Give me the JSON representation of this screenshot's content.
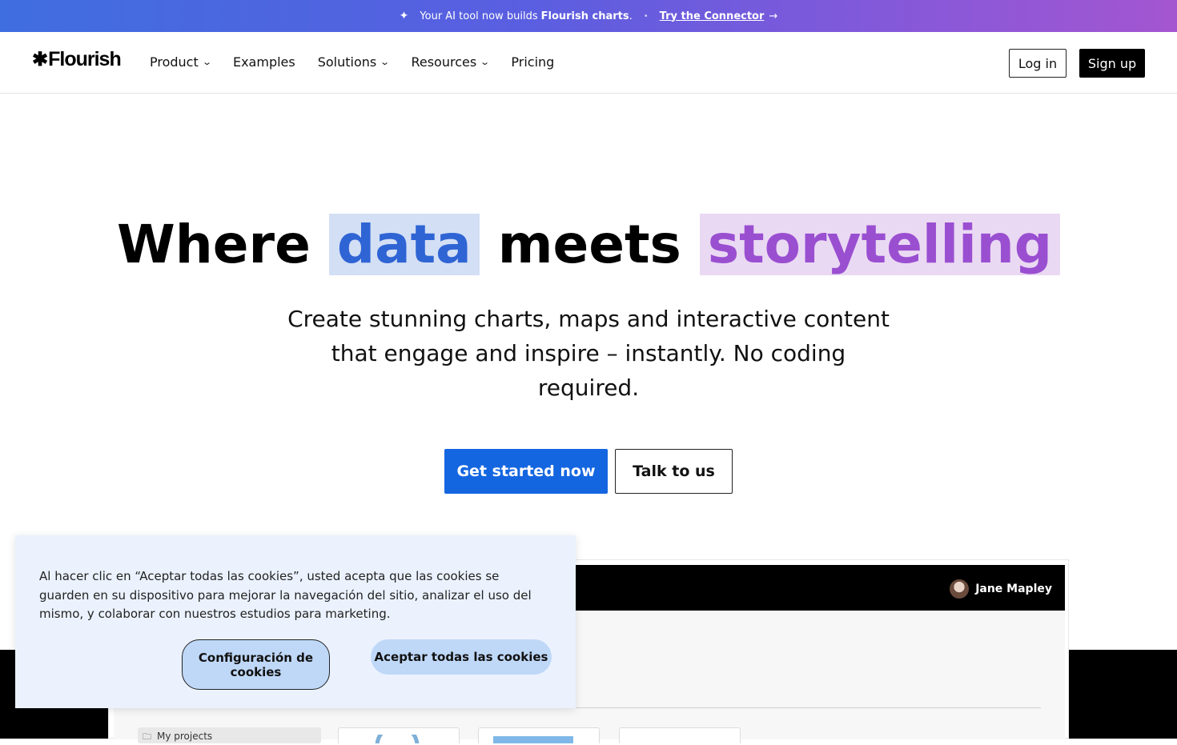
{
  "banner": {
    "text": "Your AI tool now builds",
    "bold_text": "Flourish charts",
    "period": ".",
    "link_label": "Try the Connector",
    "spark_icon": "sparkle-icon",
    "arrow_icon": "arrow-right-icon"
  },
  "nav": {
    "logo": "Flourish",
    "items": [
      {
        "label": "Product",
        "has_dropdown": true
      },
      {
        "label": "Examples",
        "has_dropdown": false
      },
      {
        "label": "Solutions",
        "has_dropdown": true
      },
      {
        "label": "Resources",
        "has_dropdown": true
      },
      {
        "label": "Pricing",
        "has_dropdown": false
      }
    ],
    "login_label": "Log in",
    "signup_label": "Sign up"
  },
  "hero": {
    "title_part1": "Where",
    "title_highlight1": "data",
    "title_part2": "meets",
    "title_highlight2": "storytelling",
    "subtitle": "Create stunning charts, maps and interactive content that engage and inspire – instantly. No coding required.",
    "primary_cta": "Get started now",
    "secondary_cta": "Talk to us",
    "highlight_blue": "#d3dff5",
    "highlight_purple": "#ead9f3"
  },
  "app_preview": {
    "user_name": "Jane Mapley",
    "folder_label": "My projects"
  },
  "cookie": {
    "text": "Al hacer clic en “Aceptar todas las cookies”, usted acepta que las cookies se guarden en su dispositivo para mejorar la navegación del sitio, analizar el uso del mismo, y colaborar con nuestros estudios para marketing.",
    "settings_label": "Configuración de cookies",
    "accept_label": "Aceptar todas las cookies"
  },
  "colors": {
    "primary": "#1466e0",
    "banner_start": "#3f6ee0",
    "banner_end": "#a456d0",
    "cookie_bg": "#ebf2fd",
    "cookie_button": "#bfd8f8"
  }
}
